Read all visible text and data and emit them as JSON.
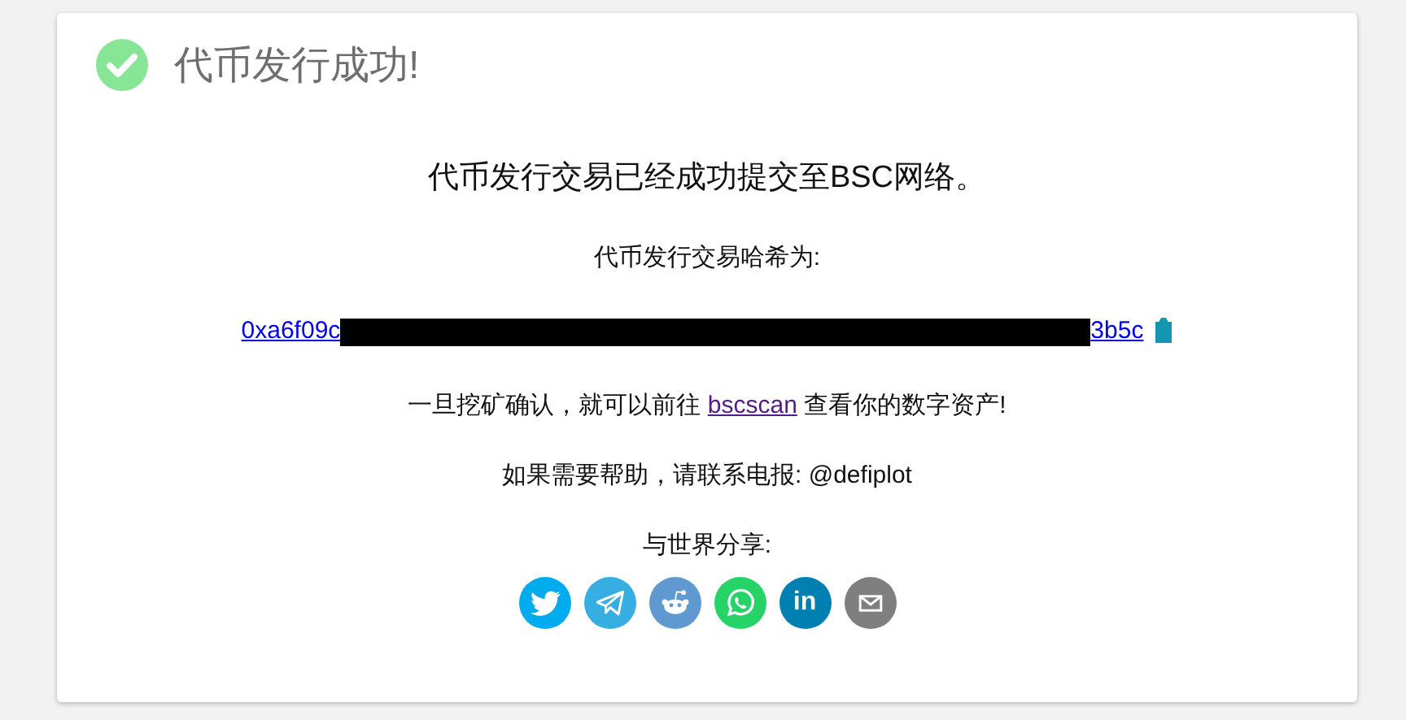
{
  "header": {
    "title": "代币发行成功!"
  },
  "message": "代币发行交易已经成功提交至BSC网络。",
  "hash_label": "代币发行交易哈希为:",
  "hash": {
    "start": "0xa6f09c",
    "end": "3b5c"
  },
  "explorer_note": {
    "before": "一旦挖矿确认，就可以前往",
    "link": "bscscan",
    "after": "查看你的数字资产!"
  },
  "help": "如果需要帮助，请联系电报: @defiplot",
  "share_label": "与世界分享:",
  "share_buttons": [
    {
      "kind": "twitter",
      "color": "#00aced"
    },
    {
      "kind": "telegram",
      "color": "#37aee2"
    },
    {
      "kind": "reddit",
      "color": "#5f99cf"
    },
    {
      "kind": "whatsapp",
      "color": "#25d366"
    },
    {
      "kind": "linkedin",
      "color": "#007fb1",
      "glyph": "in"
    },
    {
      "kind": "email",
      "color": "#7f7f7f"
    }
  ]
}
